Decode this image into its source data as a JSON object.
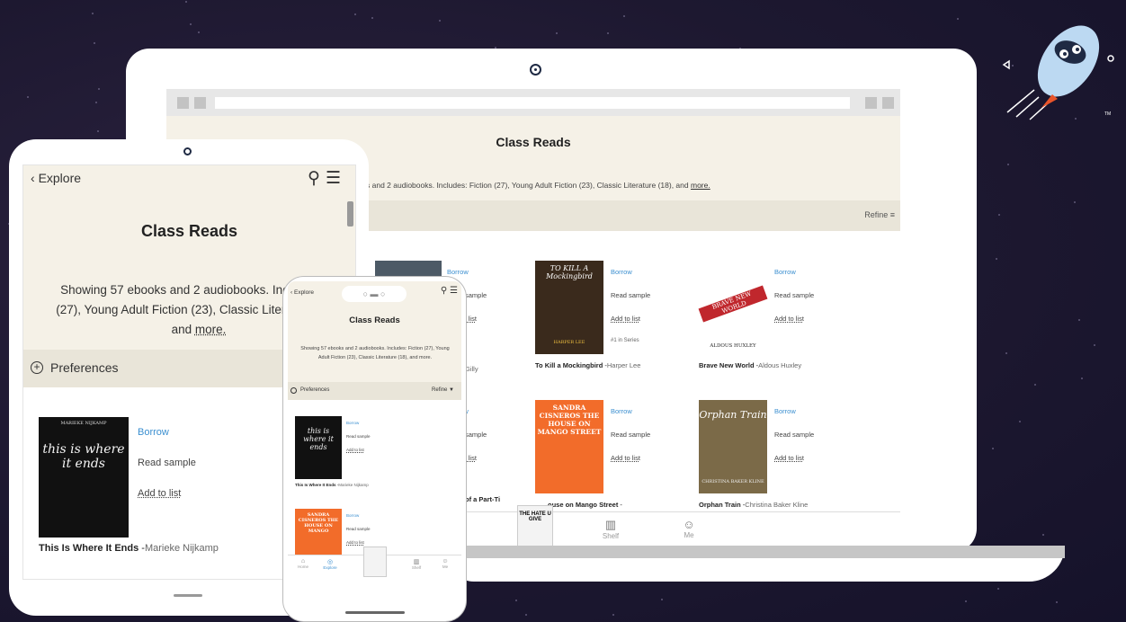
{
  "brand": {
    "background": "#1d1830",
    "accent_blue": "#3b8fd0",
    "header_beige": "#f5f1e7",
    "pref_beige": "#e9e5d9"
  },
  "mascot": {
    "name": "rocket-mascot",
    "tm": "TM"
  },
  "laptop": {
    "title": "Class Reads",
    "subtitle_prefix": "s and 2 audiobooks. Includes: Fiction (27), Young Adult Fiction (23), Classic Literature (18), and ",
    "subtitle_more": "more.",
    "refine": "Refine",
    "books": [
      {
        "title": "",
        "author": "Gilly",
        "cover": "cv-blank"
      },
      {
        "title": "To Kill a Mockingbird",
        "author": "Harper Lee",
        "series": "#1 in Series",
        "cover": "cv-mock",
        "cover_text": "TO KILL A Mockingbird",
        "cover_author": "HARPER LEE"
      },
      {
        "title": "Brave New World",
        "author": "Aldous Huxley",
        "cover": "cv-brave",
        "cover_text": "BRAVE NEW WORLD",
        "cover_author": "ALDOUS HUXLEY"
      },
      {
        "title": "of a Part-Ti",
        "author": "",
        "cover": "cv-blank"
      },
      {
        "title": "ouse on Mango Street",
        "author": "",
        "cover": "cv-house",
        "cover_text": "SANDRA CISNEROS THE HOUSE ON MANGO STREET"
      },
      {
        "title": "Orphan Train",
        "author": "Christina Baker Kline",
        "cover": "cv-orphan",
        "cover_text": "Orphan Train",
        "cover_author": "CHRISTINA BAKER KLINE"
      }
    ],
    "actions": {
      "borrow": "Borrow",
      "sample": "Read sample",
      "list": "Add to list"
    },
    "nav": [
      {
        "label": "Shelf",
        "icon": "shelf-icon"
      },
      {
        "label": "Me",
        "icon": "profile-icon"
      }
    ],
    "hate_cover": "THE HATE U GIVE"
  },
  "tablet": {
    "back": "Explore",
    "title": "Class Reads",
    "desc": "Showing 57 ebooks and 2 audiobooks. Inclu Fiction (27), Young Adult Fiction (23), Classic Literature (18), and",
    "desc_more": "more.",
    "preferences": "Preferences",
    "book": {
      "title": "This Is Where It Ends",
      "author": "Marieke Nijkamp",
      "cover_author": "MARIEKE NIJKAMP",
      "cover_text": "this is where it ends"
    },
    "actions": {
      "borrow": "Borrow",
      "sample": "Read sample",
      "list": "Add to list"
    }
  },
  "phone": {
    "back": "Explore",
    "title": "Class Reads",
    "desc": "Showing 57 ebooks and 2 audiobooks. Includes: Fiction (27), Young Adult Fiction (23), Classic Literature (18), and more.",
    "preferences": "Preferences",
    "refine": "Refine",
    "books": [
      {
        "title": "This Is Where It Ends",
        "author": "Marieke Nijkamp",
        "cover_text": "this is where it ends"
      },
      {
        "title": "",
        "author": "",
        "cover_text": "SANDRA CISNEROS THE HOUSE ON MANGO"
      }
    ],
    "actions": {
      "borrow": "Borrow",
      "sample": "Read sample",
      "list": "Add to list"
    },
    "nav": [
      {
        "label": "Home",
        "icon": "home-icon"
      },
      {
        "label": "Explore",
        "icon": "explore-icon"
      },
      {
        "label": "",
        "icon": "book-cover"
      },
      {
        "label": "Shelf",
        "icon": "shelf-icon"
      },
      {
        "label": "Me",
        "icon": "profile-icon"
      }
    ]
  }
}
